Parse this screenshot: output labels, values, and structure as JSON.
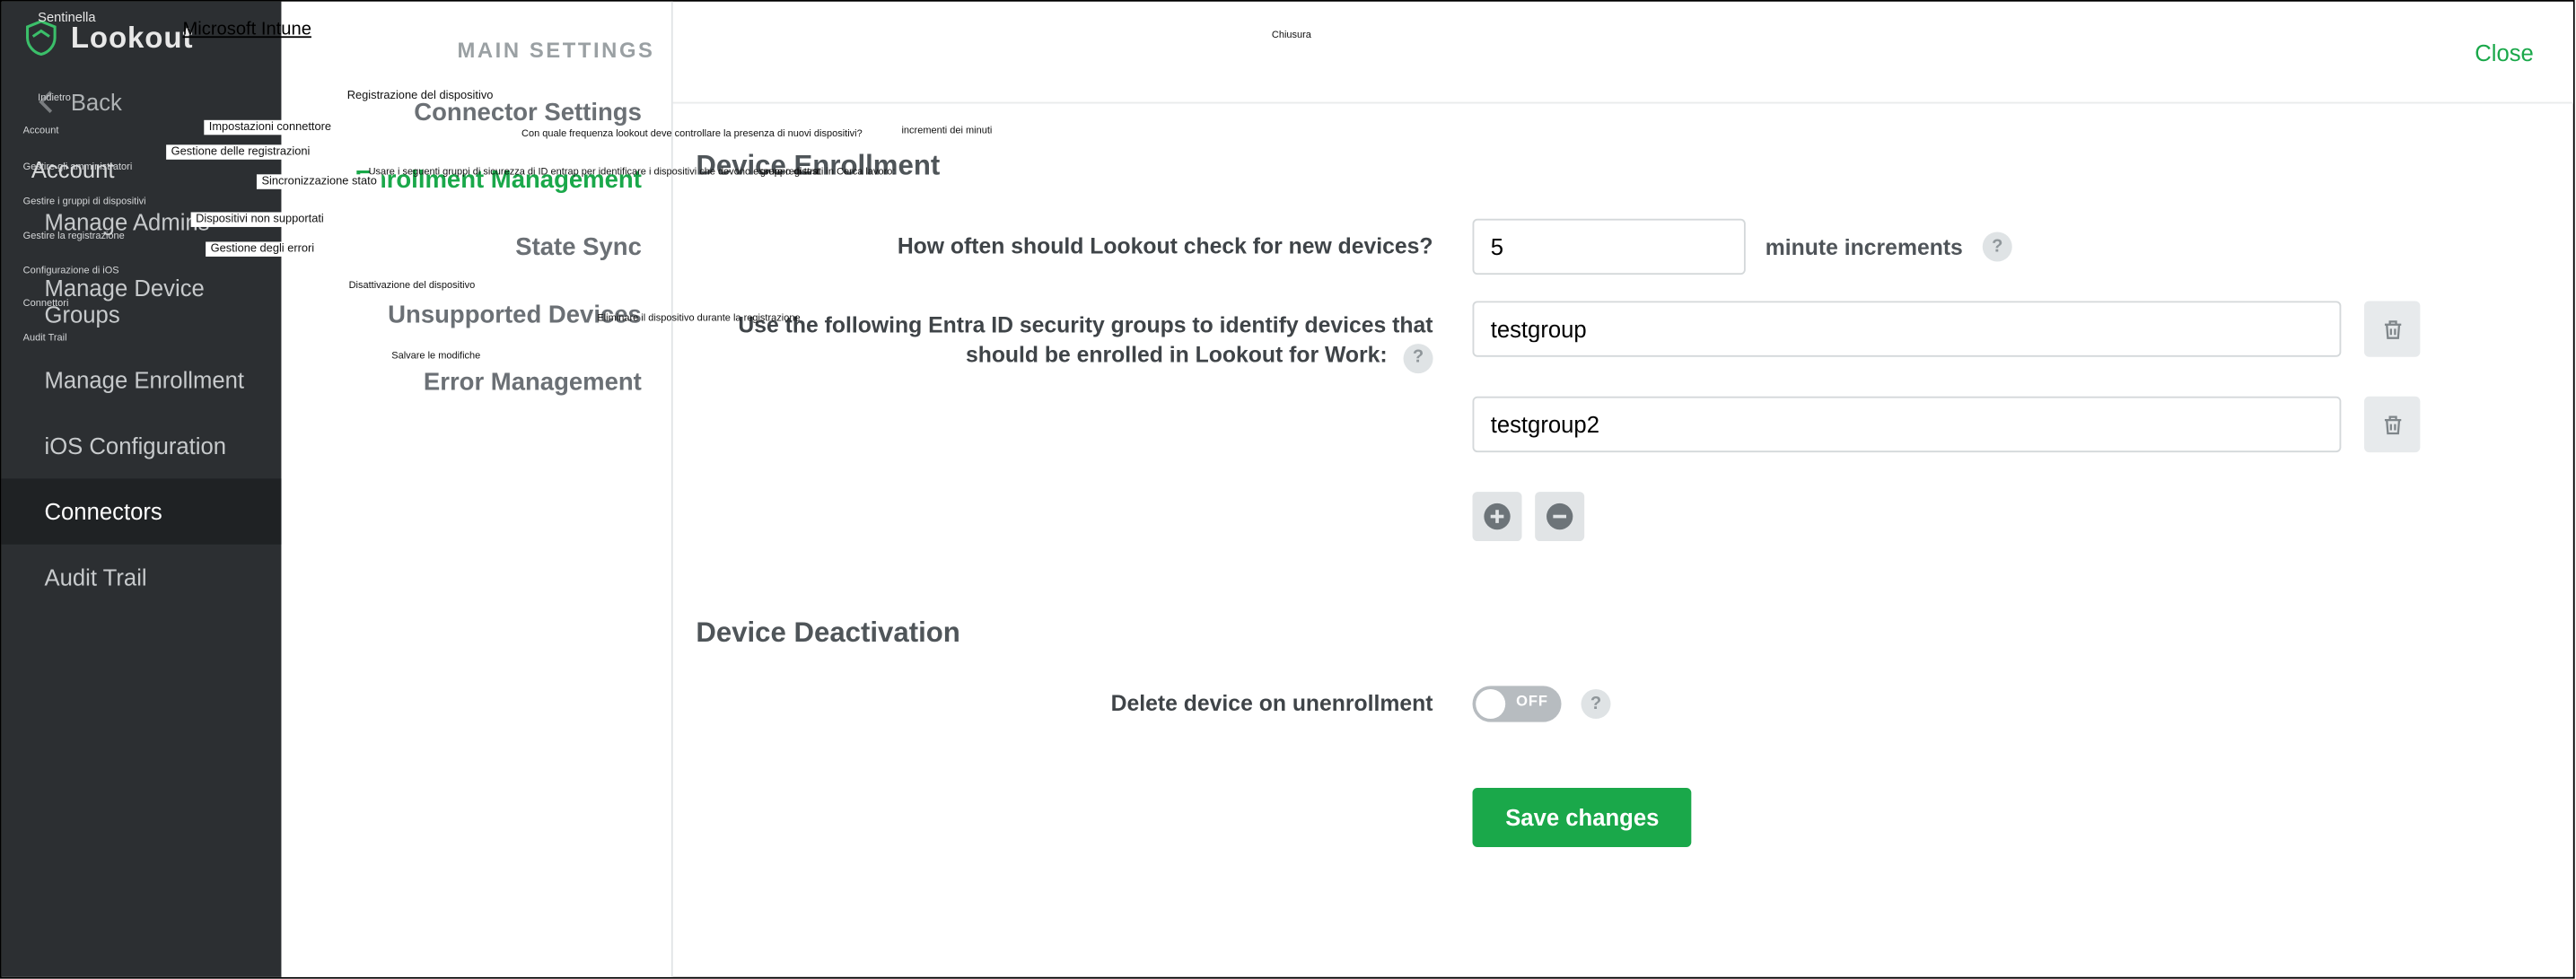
{
  "artifacts": {
    "sentinella": "Sentinella",
    "msintune_top": "Microsoft Intune",
    "indietro": "Indietro",
    "account_small": "Account",
    "gest_admin": "Gestire gli amministratori",
    "gest_gruppi": "Gestire i gruppi di dispositivi",
    "gest_reg": "Gestire la registrazione",
    "config_ios": "Configurazione di iOS",
    "connettori": "Connettori",
    "audit_trail_it": "Audit Trail",
    "chiusura": "Chiusura",
    "reg_disp": "Registrazione del dispositivo",
    "freq_check": "Con quale frequenza lookout deve controllare la presenza di nuovi dispositivi?",
    "incrementi": "incrementi dei minuti",
    "usare_gruppi": "Usare i seguenti gruppi di sicurezza di ID entrap per identificare i dispositivi che devono essere registrati in Cerca lavoro:",
    "gruppo_test": "gruppo di test",
    "impost_conn": "Impostazioni connettore",
    "gest_regs": "Gestione delle registrazioni",
    "sync_stato": "Sincronizzazione stato",
    "unsupp": "Dispositivi non supportati",
    "err_mgmt": "Gestione degli errori",
    "disatt": "Disattivazione del dispositivo",
    "elimina": "Eliminare il dispositivo durante la registrazione",
    "salva": "Salvare le modifiche"
  },
  "sidebar": {
    "brand": "Lookout",
    "back": "Back",
    "account_section": "Account",
    "items": [
      "Manage Admins",
      "Manage Device Groups",
      "Manage Enrollment",
      "iOS Configuration",
      "Connectors",
      "Audit Trail"
    ],
    "active_index": 4
  },
  "subnav": {
    "heading": "MAIN SETTINGS",
    "items": [
      "Connector Settings",
      "Enrollment Management",
      "State Sync",
      "Unsupported Devices",
      "Error Management"
    ],
    "active_index": 1
  },
  "header": {
    "brand": "Microsoft Intune",
    "close": "Close"
  },
  "content": {
    "enrollment_title": "Device Enrollment",
    "check_label": "How often should Lookout check for new devices?",
    "check_value": "5",
    "check_suffix": "minute increments",
    "groups_label_pre": "Use the following ",
    "groups_label_strong": "Entra ID",
    "groups_label_post": " security groups to identify devices that should be enrolled in Lookout for Work:",
    "groups": [
      "testgroup",
      "testgroup2"
    ],
    "deact_title": "Device Deactivation",
    "delete_label": "Delete device on unenrollment",
    "toggle_state": "OFF",
    "save": "Save changes",
    "help": "?"
  }
}
